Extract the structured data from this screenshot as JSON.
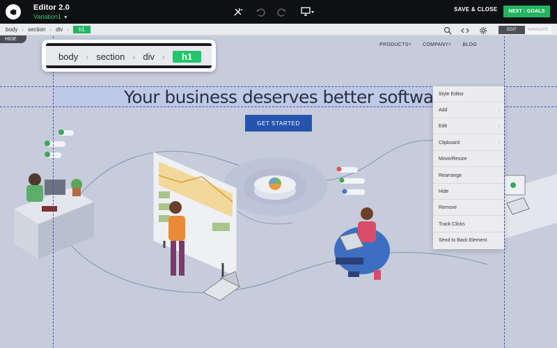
{
  "editor": {
    "title": "Editor 2.0",
    "variation": "Variation1",
    "save_close": "SAVE & CLOSE",
    "next_goals": "NEXT : GOALS"
  },
  "breadcrumb": {
    "items": [
      "body",
      "section",
      "div",
      "h1"
    ]
  },
  "modes": {
    "edit": "EDIT",
    "navigate": "NAVIGATE"
  },
  "hide_tab": "HIDE",
  "site": {
    "nav": [
      "PRODUCTS˅",
      "COMPANY˅",
      "BLOG"
    ],
    "headline": "Your business deserves better software",
    "cta": "GET STARTED"
  },
  "context_menu": {
    "items": [
      {
        "label": "Style Editor",
        "submenu": false
      },
      {
        "label": "Add",
        "submenu": true
      },
      {
        "label": "Edit",
        "submenu": true
      },
      {
        "label": "Clipboard",
        "submenu": true
      },
      {
        "label": "Move/Resize",
        "submenu": false
      },
      {
        "label": "Rearrange",
        "submenu": false
      },
      {
        "label": "Hide",
        "submenu": false
      },
      {
        "label": "Remove",
        "submenu": false
      },
      {
        "label": "Track Clicks",
        "submenu": false
      },
      {
        "label": "Send to Back Element",
        "submenu": false
      }
    ]
  },
  "colors": {
    "accent": "#23b462",
    "cta": "#2554ae",
    "topbar": "#0f1013"
  }
}
